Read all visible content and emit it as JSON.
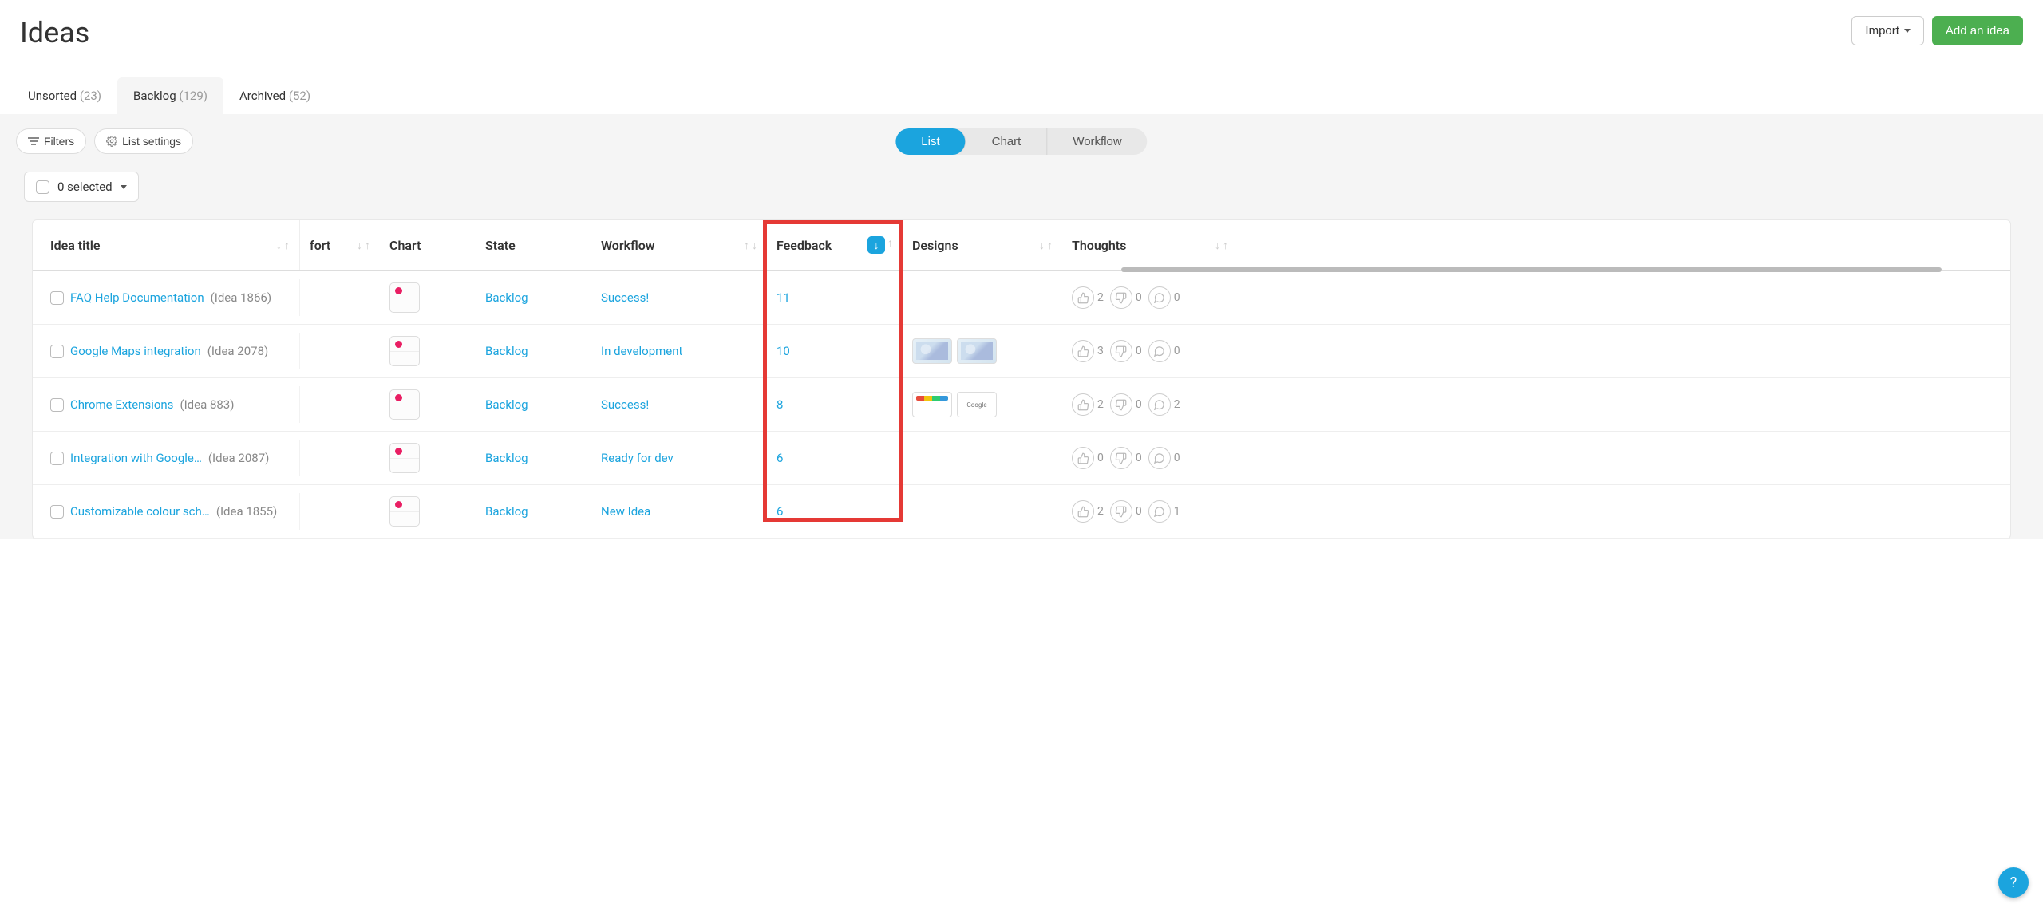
{
  "header": {
    "title": "Ideas",
    "import_label": "Import",
    "add_label": "Add an idea"
  },
  "tabs": [
    {
      "label": "Unsorted",
      "count": "(23)",
      "active": false
    },
    {
      "label": "Backlog",
      "count": "(129)",
      "active": true
    },
    {
      "label": "Archived",
      "count": "(52)",
      "active": false
    }
  ],
  "toolbar": {
    "filters_label": "Filters",
    "list_settings_label": "List settings",
    "views": {
      "list": "List",
      "chart": "Chart",
      "workflow": "Workflow"
    }
  },
  "selection": {
    "label": "0 selected"
  },
  "columns": {
    "title": "Idea title",
    "effort_partial": "fort",
    "chart": "Chart",
    "state": "State",
    "workflow": "Workflow",
    "feedback": "Feedback",
    "designs": "Designs",
    "thoughts": "Thoughts"
  },
  "rows": [
    {
      "title": "FAQ Help Documentation",
      "idref": "(Idea 1866)",
      "state": "Backlog",
      "workflow": "Success!",
      "feedback": "11",
      "designs": [],
      "thoughts": {
        "up": "2",
        "down": "0",
        "comment": "0"
      }
    },
    {
      "title": "Google Maps integration",
      "idref": "(Idea 2078)",
      "state": "Backlog",
      "workflow": "In development",
      "feedback": "10",
      "designs": [
        "map1",
        "map1"
      ],
      "thoughts": {
        "up": "3",
        "down": "0",
        "comment": "0"
      }
    },
    {
      "title": "Chrome Extensions",
      "idref": "(Idea 883)",
      "state": "Backlog",
      "workflow": "Success!",
      "feedback": "8",
      "designs": [
        "chrome1",
        "chrome2"
      ],
      "thoughts": {
        "up": "2",
        "down": "0",
        "comment": "2"
      }
    },
    {
      "title": "Integration with Google…",
      "idref": "(Idea 2087)",
      "state": "Backlog",
      "workflow": "Ready for dev",
      "feedback": "6",
      "designs": [],
      "thoughts": {
        "up": "0",
        "down": "0",
        "comment": "0"
      }
    },
    {
      "title": "Customizable colour sch…",
      "idref": "(Idea 1855)",
      "state": "Backlog",
      "workflow": "New Idea",
      "feedback": "6",
      "designs": [],
      "thoughts": {
        "up": "2",
        "down": "0",
        "comment": "1"
      }
    }
  ],
  "google_thumb_text": "Google",
  "help_label": "?"
}
